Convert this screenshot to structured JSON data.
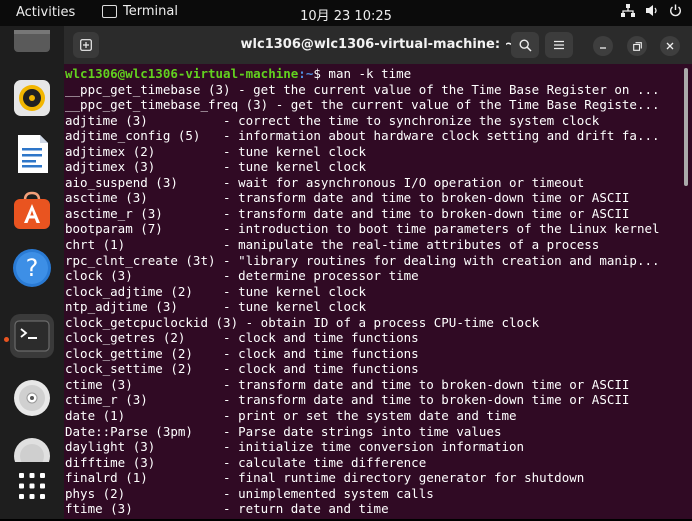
{
  "topbar": {
    "activities": "Activities",
    "app_name": "Terminal",
    "clock": "10月 23  10:25"
  },
  "dock": {
    "items": [
      "files-app",
      "rhythmbox",
      "libreoffice-writer",
      "ubuntu-software",
      "help",
      "terminal",
      "dvd",
      "show-apps"
    ]
  },
  "window": {
    "title": "wlc1306@wlc1306-virtual-machine: ~"
  },
  "terminal": {
    "prompt_user": "wlc1306@wlc1306-virtual-machine",
    "prompt_path": ":~",
    "prompt_symbol": "$ ",
    "command": "man -k time",
    "lines": [
      "__ppc_get_timebase (3) - get the current value of the Time Base Register on ...",
      "__ppc_get_timebase_freq (3) - get the current value of the Time Base Registe...",
      "adjtime (3)          - correct the time to synchronize the system clock",
      "adjtime_config (5)   - information about hardware clock setting and drift fa...",
      "adjtimex (2)         - tune kernel clock",
      "adjtimex (3)         - tune kernel clock",
      "aio_suspend (3)      - wait for asynchronous I/O operation or timeout",
      "asctime (3)          - transform date and time to broken-down time or ASCII",
      "asctime_r (3)        - transform date and time to broken-down time or ASCII",
      "bootparam (7)        - introduction to boot time parameters of the Linux kernel",
      "chrt (1)             - manipulate the real-time attributes of a process",
      "rpc_clnt_create (3t) - \"library routines for dealing with creation and manip...",
      "clock (3)            - determine processor time",
      "clock_adjtime (2)    - tune kernel clock",
      "ntp_adjtime (3)      - tune kernel clock",
      "clock_getcpuclockid (3) - obtain ID of a process CPU-time clock",
      "clock_getres (2)     - clock and time functions",
      "clock_gettime (2)    - clock and time functions",
      "clock_settime (2)    - clock and time functions",
      "ctime (3)            - transform date and time to broken-down time or ASCII",
      "ctime_r (3)          - transform date and time to broken-down time or ASCII",
      "date (1)             - print or set the system date and time",
      "Date::Parse (3pm)    - Parse date strings into time values",
      "daylight (3)         - initialize time conversion information",
      "difftime (3)         - calculate time difference",
      "finalrd (1)          - final runtime directory generator for shutdown",
      "phys (2)             - unimplemented system calls",
      "ftime (3)            - return date and time"
    ]
  },
  "colors": {
    "terminal_bg": "#300a24",
    "prompt_user": "#62d11f",
    "prompt_path": "#4f8ede",
    "dock_bg": "#1e1e1e",
    "accent_orange": "#e95420"
  }
}
